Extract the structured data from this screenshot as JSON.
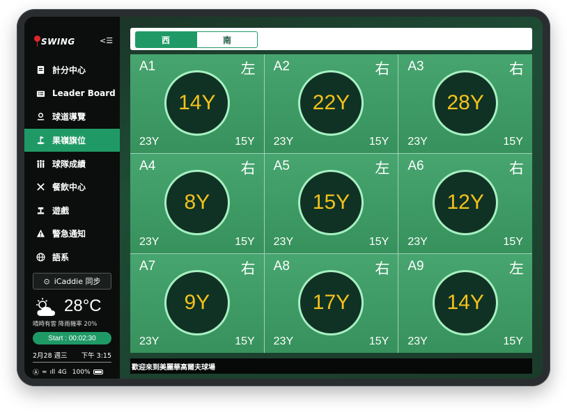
{
  "app": {
    "logo_text": "SWING",
    "collapse_icon": "collapse-menu-icon",
    "collapse_glyph": "<☰"
  },
  "sidebar": {
    "items": [
      {
        "label": "計分中心",
        "icon": "scorecard-icon",
        "active": false
      },
      {
        "label": "Leader Board",
        "icon": "leaderboard-icon",
        "active": false
      },
      {
        "label": "球道導覽",
        "icon": "course-guide-icon",
        "active": false
      },
      {
        "label": "果嶺旗位",
        "icon": "green-flag-icon",
        "active": true
      },
      {
        "label": "球隊成績",
        "icon": "team-score-icon",
        "active": false
      },
      {
        "label": "餐飲中心",
        "icon": "dining-icon",
        "active": false
      },
      {
        "label": "遊戲",
        "icon": "game-icon",
        "active": false
      },
      {
        "label": "警急通知",
        "icon": "alert-icon",
        "active": false
      },
      {
        "label": "語系",
        "icon": "language-icon",
        "active": false
      }
    ],
    "icaddie_label": "iCaddie 同步",
    "weather": {
      "temp": "28°C",
      "desc": "晴時有雲  降雨機率 20%"
    },
    "start_label": "Start : 00:02:30",
    "date": "2月28 週三",
    "time": "下午 3:15",
    "status": {
      "signal": "4G",
      "battery": "100%"
    }
  },
  "tabs": [
    {
      "label": "西",
      "active": true
    },
    {
      "label": "南",
      "active": false
    }
  ],
  "holes": [
    {
      "id": "A1",
      "side": "左",
      "distance": "14Y",
      "left": "23Y",
      "right": "15Y"
    },
    {
      "id": "A2",
      "side": "右",
      "distance": "22Y",
      "left": "23Y",
      "right": "15Y"
    },
    {
      "id": "A3",
      "side": "右",
      "distance": "28Y",
      "left": "23Y",
      "right": "15Y"
    },
    {
      "id": "A4",
      "side": "右",
      "distance": "8Y",
      "left": "23Y",
      "right": "15Y"
    },
    {
      "id": "A5",
      "side": "左",
      "distance": "15Y",
      "left": "23Y",
      "right": "15Y"
    },
    {
      "id": "A6",
      "side": "右",
      "distance": "12Y",
      "left": "23Y",
      "right": "15Y"
    },
    {
      "id": "A7",
      "side": "右",
      "distance": "9Y",
      "left": "23Y",
      "right": "15Y"
    },
    {
      "id": "A8",
      "side": "右",
      "distance": "17Y",
      "left": "23Y",
      "right": "15Y"
    },
    {
      "id": "A9",
      "side": "左",
      "distance": "14Y",
      "left": "23Y",
      "right": "15Y"
    }
  ],
  "ticker": "歡迎來到美麗華高爾夫球場",
  "colors": {
    "accent": "#1f9a66",
    "distance_text": "#f4c21c",
    "cell_green": "#3f9b66"
  }
}
